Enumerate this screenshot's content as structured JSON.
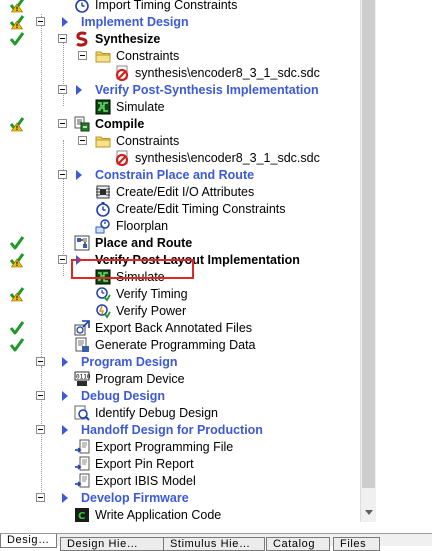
{
  "tree": {
    "rows": [
      {
        "label": "Import Timing Constraints",
        "style": "normal",
        "status": "warn",
        "icon": "timer-icon"
      },
      {
        "label": "Implement Design",
        "style": "category",
        "status": "warn",
        "icon": "expand-arrow-icon"
      },
      {
        "label": "Synthesize",
        "style": "bold",
        "status": "ok",
        "icon": "synplify-s-icon"
      },
      {
        "label": "Constraints",
        "style": "normal",
        "status": "none",
        "icon": "folder-icon"
      },
      {
        "label": "synthesis\\encoder8_3_1_sdc.sdc",
        "style": "normal",
        "status": "none",
        "icon": "sdc-constraint-file-icon"
      },
      {
        "label": "Verify Post-Synthesis Implementation",
        "style": "category",
        "status": "none",
        "icon": "expand-arrow-icon"
      },
      {
        "label": "Simulate",
        "style": "normal",
        "status": "none",
        "icon": "simulate-icon"
      },
      {
        "label": "Compile",
        "style": "bold",
        "status": "warn",
        "icon": "compile-icon"
      },
      {
        "label": "Constraints",
        "style": "normal",
        "status": "none",
        "icon": "folder-icon"
      },
      {
        "label": "synthesis\\encoder8_3_1_sdc.sdc",
        "style": "normal",
        "status": "none",
        "icon": "sdc-constraint-file-icon"
      },
      {
        "label": "Constrain Place and Route",
        "style": "category",
        "status": "none",
        "icon": "expand-arrow-icon"
      },
      {
        "label": "Create/Edit I/O Attributes",
        "style": "normal",
        "status": "none",
        "icon": "io-attributes-icon"
      },
      {
        "label": "Create/Edit Timing Constraints",
        "style": "normal",
        "status": "none",
        "icon": "timer-icon"
      },
      {
        "label": "Floorplan",
        "style": "normal",
        "status": "none",
        "icon": "floorplan-icon"
      },
      {
        "label": "Place and Route",
        "style": "bold",
        "status": "ok",
        "icon": "place-route-icon"
      },
      {
        "label": "Verify Post Layout Implementation",
        "style": "bold",
        "status": "warn",
        "icon": "expand-arrow-icon"
      },
      {
        "label": "Simulate",
        "style": "normal",
        "status": "none",
        "icon": "simulate-icon"
      },
      {
        "label": "Verify Timing",
        "style": "normal",
        "status": "warn",
        "icon": "verify-timing-icon"
      },
      {
        "label": "Verify Power",
        "style": "normal",
        "status": "none",
        "icon": "verify-power-icon"
      },
      {
        "label": "Export Back Annotated Files",
        "style": "normal",
        "status": "ok",
        "icon": "export-annotated-icon"
      },
      {
        "label": "Generate Programming Data",
        "style": "normal",
        "status": "ok",
        "icon": "programming-data-icon"
      },
      {
        "label": "Program Design",
        "style": "category",
        "status": "none",
        "icon": "expand-arrow-icon"
      },
      {
        "label": "Program Device",
        "style": "normal",
        "status": "none",
        "icon": "program-device-icon"
      },
      {
        "label": "Debug Design",
        "style": "category",
        "status": "none",
        "icon": "expand-arrow-icon"
      },
      {
        "label": "Identify Debug Design",
        "style": "normal",
        "status": "none",
        "icon": "identify-debug-icon"
      },
      {
        "label": "Handoff Design for Production",
        "style": "category",
        "status": "none",
        "icon": "expand-arrow-icon"
      },
      {
        "label": "Export Programming File",
        "style": "normal",
        "status": "none",
        "icon": "export-file-icon"
      },
      {
        "label": "Export Pin Report",
        "style": "normal",
        "status": "none",
        "icon": "export-file-icon"
      },
      {
        "label": "Export IBIS Model",
        "style": "normal",
        "status": "none",
        "icon": "export-file-icon"
      },
      {
        "label": "Develop Firmware",
        "style": "category",
        "status": "none",
        "icon": "expand-arrow-icon"
      },
      {
        "label": "Write Application Code",
        "style": "normal",
        "status": "none",
        "icon": "write-code-icon"
      }
    ]
  },
  "tabs": [
    {
      "label": "Desig…"
    },
    {
      "label": "Design Hie…"
    },
    {
      "label": "Stimulus Hie…"
    },
    {
      "label": "Catalog"
    },
    {
      "label": "Files"
    }
  ],
  "colors": {
    "category_text": "#3c5ad8",
    "ok_check": "#1f9a2a",
    "highlight_box": "#e0282b"
  }
}
